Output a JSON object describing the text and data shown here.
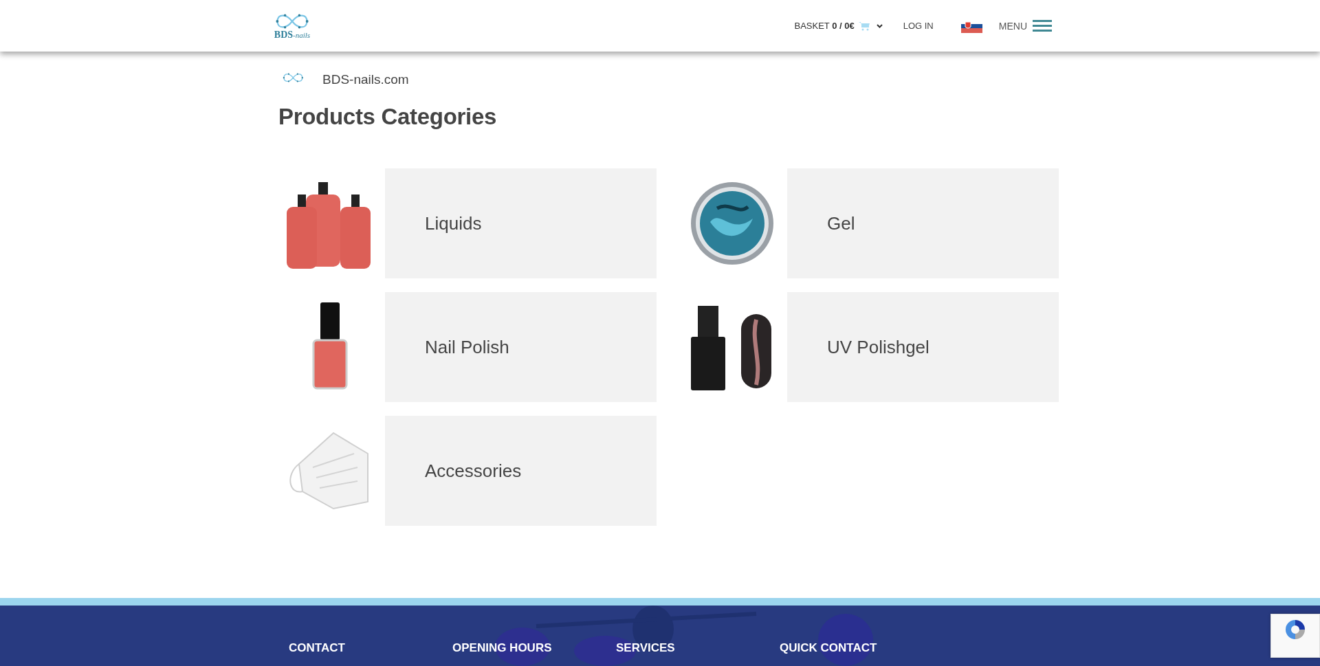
{
  "header": {
    "logo_text": "BDS",
    "logo_suffix": "-nails",
    "basket": "BASKET **0 / 0€**",
    "login": "LOG IN",
    "menu": "MENU"
  },
  "breadcrumb": "BDS-nails.com",
  "title": "Products Categories",
  "categories": [
    {
      "name": "Liquids",
      "kind": "bottles"
    },
    {
      "name": "Gel",
      "kind": "jar"
    },
    {
      "name": "Nail Polish",
      "kind": "polish"
    },
    {
      "name": "UV Polishgel",
      "kind": "polishgel"
    },
    {
      "name": "Accessories",
      "kind": "mask"
    }
  ],
  "footer": {
    "columns": [
      "CONTACT",
      "OPENING HOURS",
      "SERVICES",
      "QUICK CONTACT"
    ]
  }
}
